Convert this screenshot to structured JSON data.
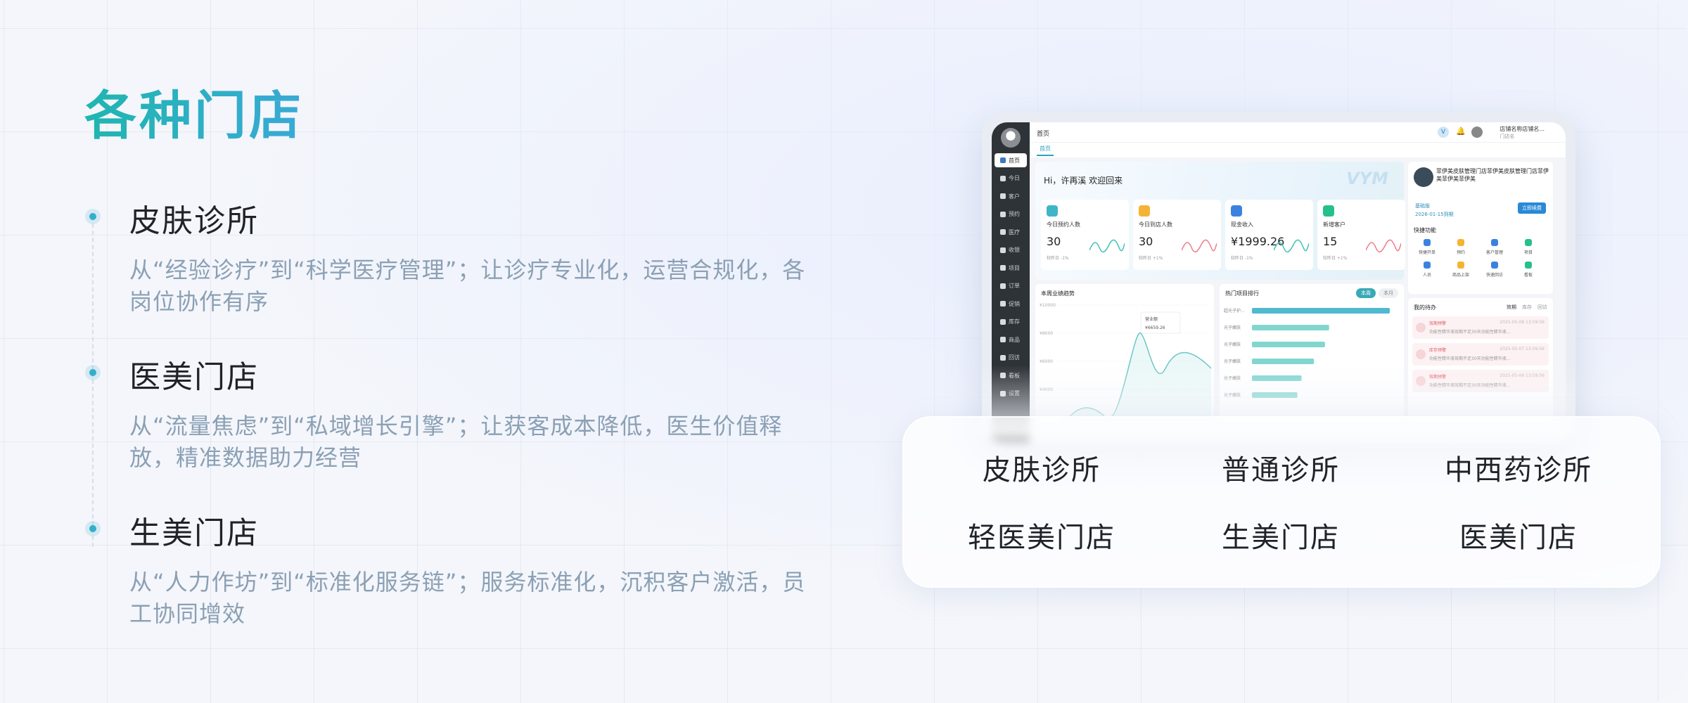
{
  "title": "各种门店",
  "sections": [
    {
      "title": "皮肤诊所",
      "desc": "从“经验诊疗”到“科学医疗管理”；让诊疗专业化，运营合规化，各岗位协作有序"
    },
    {
      "title": "医美门店",
      "desc": "从“流量焦虑”到“私域增长引擎”；让获客成本降低，医生价值释放，精准数据助力经营"
    },
    {
      "title": "生美门店",
      "desc": "从“人力作坊”到“标准化服务链”；服务标准化，沉积客户激活，员工协同增效"
    }
  ],
  "store_types": [
    "皮肤诊所",
    "普通诊所",
    "中西药诊所",
    "轻医美门店",
    "生美门店",
    "医美门店"
  ],
  "dashboard": {
    "breadcrumb": "首页",
    "tab": "首页",
    "store_name": "店铺名称店铺名...",
    "store_sub": "门店名",
    "badge": "V",
    "sidebar": [
      "首页",
      "今日",
      "客户",
      "预约",
      "医疗",
      "收银",
      "项目",
      "订单",
      "促销",
      "库存",
      "商品",
      "回访",
      "看板",
      "设置"
    ],
    "welcome": "Hi，许再溪 欢迎回来",
    "brand": "VYM",
    "stats": [
      {
        "label": "今日预约人数",
        "value": "30",
        "sub": "较昨日 -1%",
        "color": "#3fb6c8"
      },
      {
        "label": "今日到店人数",
        "value": "30",
        "sub": "较昨日 +1%",
        "color": "#f5b335"
      },
      {
        "label": "现金收入",
        "value": "¥1999.26",
        "sub": "较昨日 -1%",
        "color": "#3b82e0"
      },
      {
        "label": "新增客户",
        "value": "15",
        "sub": "较昨日 +1%",
        "color": "#26c08a"
      }
    ],
    "profile": {
      "name": "菲伊美皮肤管理门店菲伊美皮肤管理门店菲伊美菲伊美菲伊美",
      "level": "基础版",
      "expire": "2026-01-15到期",
      "renew": "立即续费",
      "quick_title": "快捷功能",
      "quick": [
        "快捷开单",
        "预约",
        "客户管理",
        "项目",
        "人员",
        "商品上架",
        "快速回访",
        "看板"
      ]
    },
    "trend_title": "本周业绩趋势",
    "trend_y_ticks": [
      "¥10000",
      "¥8000",
      "¥6000",
      "¥4000"
    ],
    "trend_tooltip_label": "营业额",
    "trend_tooltip_value": "¥6659.26",
    "rank_title": "热门项目排行",
    "rank_tabs": [
      "本周",
      "本月"
    ],
    "rank_items": [
      {
        "name": "超光子护...",
        "value": 100
      },
      {
        "name": "光子嫩肤",
        "value": 56
      },
      {
        "name": "光子嫩肤",
        "value": 53
      },
      {
        "name": "光子嫩肤",
        "value": 45
      },
      {
        "name": "光子嫩肤",
        "value": 36
      },
      {
        "name": "光子嫩肤",
        "value": 33
      }
    ],
    "todo_title": "我的待办",
    "todo_tabs": [
      "效期",
      "库存",
      "回访"
    ],
    "todos": [
      {
        "title": "效期预警",
        "time": "2025-05-08 13:59:56",
        "desc": "功能性精华液效期不足30天功能性精华液..."
      },
      {
        "title": "库存预警",
        "time": "2025-05-07 13:59:56",
        "desc": "功能性精华液效期不足30天功能性精华液..."
      },
      {
        "title": "效期预警",
        "time": "2025-05-06 13:59:56",
        "desc": "功能性精华液效期不足30天功能性精华液..."
      }
    ]
  }
}
